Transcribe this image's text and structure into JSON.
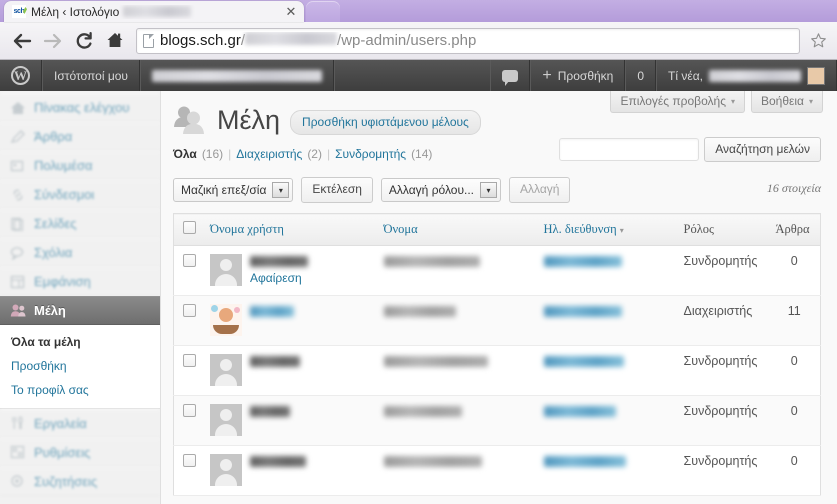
{
  "browser": {
    "tab_title_prefix": "Μέλη ‹ Ιστολόγιο",
    "tab_close_glyph": "✕",
    "favicon_text": "sch",
    "url_domain": "blogs.sch.gr",
    "url_path_suffix": "/wp-admin/users.php",
    "back_label": "Πίσω",
    "forward_label": "Εμπρός",
    "reload_label": "Επαναφόρτωση",
    "home_label": "Αρχική",
    "bookmark_label": "Προσθήκη σελιδοδείκτη"
  },
  "adminbar": {
    "logo_glyph": "W",
    "my_sites": "Ιστότοποί μου",
    "comments_count": "0",
    "new_label": "Προσθήκη",
    "howdy": "Τί νέα,"
  },
  "sidebar": {
    "items": [
      {
        "label": "Πίνακας ελέγχου",
        "icon": "dashboard-icon",
        "name": "sidebar-item-dashboard"
      },
      {
        "label": "Άρθρα",
        "icon": "posts-icon",
        "name": "sidebar-item-posts"
      },
      {
        "label": "Πολυμέσα",
        "icon": "media-icon",
        "name": "sidebar-item-media"
      },
      {
        "label": "Σύνδεσμοι",
        "icon": "links-icon",
        "name": "sidebar-item-links"
      },
      {
        "label": "Σελίδες",
        "icon": "pages-icon",
        "name": "sidebar-item-pages"
      },
      {
        "label": "Σχόλια",
        "icon": "comments-icon",
        "name": "sidebar-item-comments"
      },
      {
        "label": "Εμφάνιση",
        "icon": "appearance-icon",
        "name": "sidebar-item-appearance"
      }
    ],
    "active_item": {
      "label": "Μέλη",
      "icon": "users-icon"
    },
    "submenu": [
      {
        "label": "Όλα τα μέλη",
        "current": true
      },
      {
        "label": "Προσθήκη",
        "current": false
      },
      {
        "label": "Το προφίλ σας",
        "current": false
      }
    ],
    "items_after": [
      {
        "label": "Εργαλεία",
        "icon": "tools-icon",
        "name": "sidebar-item-tools"
      },
      {
        "label": "Ρυθμίσεις",
        "icon": "settings-icon",
        "name": "sidebar-item-settings"
      },
      {
        "label": "Συζητήσεις",
        "icon": "discussion-icon",
        "name": "sidebar-item-discussion"
      }
    ]
  },
  "screen_meta": {
    "screen_options": "Επιλογές προβολής",
    "help": "Βοήθεια",
    "caret": "▾"
  },
  "page": {
    "title": "Μέλη",
    "add_existing_button": "Προσθήκη υφιστάμενου μέλους",
    "filters": [
      {
        "label": "Όλα",
        "count": "(16)",
        "current": true
      },
      {
        "label": "Διαχειριστής",
        "count": "(2)",
        "current": false
      },
      {
        "label": "Συνδρομητής",
        "count": "(14)",
        "current": false
      }
    ],
    "filter_separator": "|",
    "search_value": "",
    "search_button": "Αναζήτηση μελών",
    "bulk_action": "Μαζική επεξ/σία",
    "bulk_apply": "Εκτέλεση",
    "role_change": "Αλλαγή ρόλου...",
    "role_apply": "Αλλαγή",
    "items_count": "16 στοιχεία",
    "select_arrow": "▾"
  },
  "table": {
    "headers": [
      {
        "label": "Όνομα χρήστη",
        "sortable": true,
        "sorted": false
      },
      {
        "label": "Όνομα",
        "sortable": true,
        "sorted": false
      },
      {
        "label": "Ηλ. διεύθυνση",
        "sortable": true,
        "sorted": true
      },
      {
        "label": "Ρόλος",
        "sortable": false,
        "sorted": false
      },
      {
        "label": "Άρθρα",
        "sortable": false,
        "sorted": false
      }
    ],
    "sort_indicator": "▾",
    "row_action_remove": "Αφαίρεση",
    "rows": [
      {
        "username_redacted": true,
        "username_width": 58,
        "name_redacted": true,
        "name_width": 96,
        "email_redacted": true,
        "email_width": 78,
        "role": "Συνδρομητής",
        "posts": "0",
        "avatar": "default",
        "show_row_actions": true
      },
      {
        "username_redacted": true,
        "username_width": 44,
        "name_redacted": true,
        "name_width": 72,
        "email_redacted": true,
        "email_width": 78,
        "role": "Διαχειριστής",
        "posts": "11",
        "avatar": "custom",
        "show_row_actions": false
      },
      {
        "username_redacted": true,
        "username_width": 50,
        "name_redacted": true,
        "name_width": 104,
        "email_redacted": true,
        "email_width": 80,
        "role": "Συνδρομητής",
        "posts": "0",
        "avatar": "default",
        "show_row_actions": false
      },
      {
        "username_redacted": true,
        "username_width": 40,
        "name_redacted": true,
        "name_width": 78,
        "email_redacted": true,
        "email_width": 72,
        "role": "Συνδρομητής",
        "posts": "0",
        "avatar": "default",
        "show_row_actions": false
      },
      {
        "username_redacted": true,
        "username_width": 56,
        "name_redacted": true,
        "name_width": 98,
        "email_redacted": true,
        "email_width": 82,
        "role": "Συνδρομητής",
        "posts": "0",
        "avatar": "default",
        "show_row_actions": false
      }
    ]
  },
  "colors": {
    "link": "#21759b",
    "admin_bar": "#464646",
    "active_menu": "#777777",
    "chrome_theme": "#b39ddb"
  }
}
